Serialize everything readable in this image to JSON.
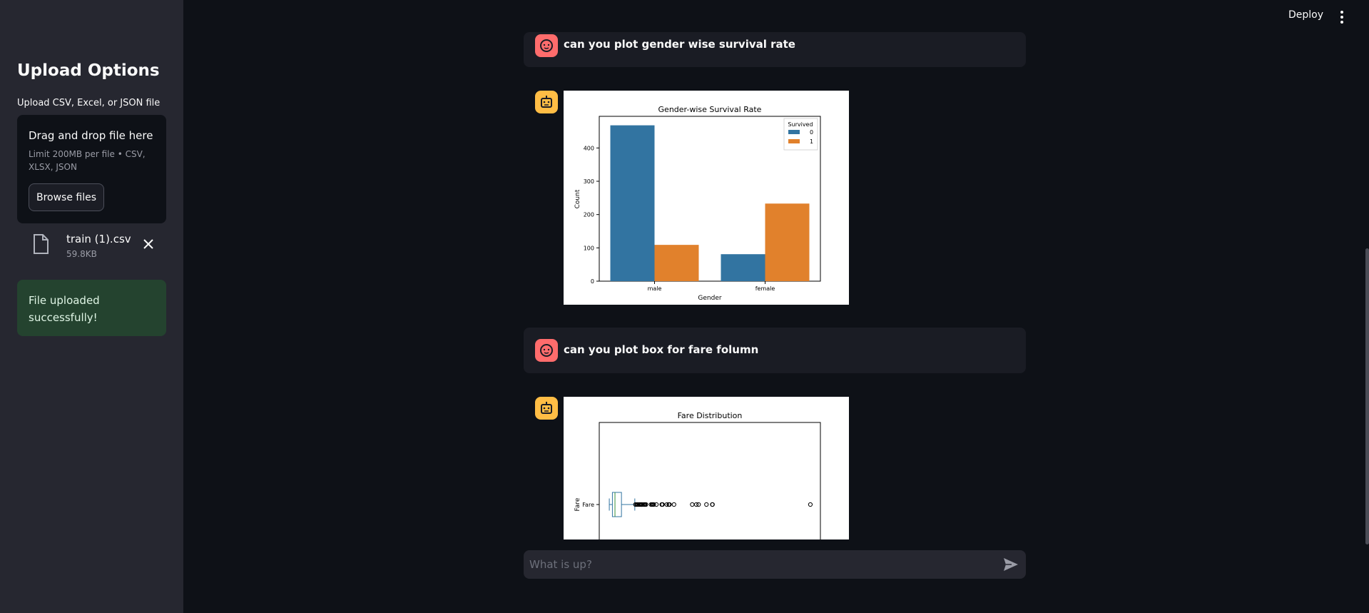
{
  "sidebar": {
    "title": "Upload Options",
    "upload_label": "Upload CSV, Excel, or JSON file",
    "dropzone": {
      "title": "Drag and drop file here",
      "limit": "Limit 200MB per file • CSV, XLSX, JSON",
      "browse_label": "Browse files"
    },
    "file": {
      "name": "train (1).csv",
      "size": "59.8KB"
    },
    "success_message": "File uploaded successfully!"
  },
  "header": {
    "deploy_label": "Deploy"
  },
  "chat": {
    "messages": [
      {
        "role": "user",
        "text": "can you plot gender wise survival rate"
      },
      {
        "role": "assistant",
        "content": "chart"
      },
      {
        "role": "user",
        "text": "can you plot box for fare folumn"
      },
      {
        "role": "assistant",
        "content": "chart"
      }
    ],
    "input_placeholder": "What is up?"
  },
  "chart_data": [
    {
      "type": "bar",
      "title": "Gender-wise Survival Rate",
      "xlabel": "Gender",
      "ylabel": "Count",
      "categories": [
        "male",
        "female"
      ],
      "series": [
        {
          "name": "0",
          "values": [
            468,
            81
          ],
          "color": "#3274a1"
        },
        {
          "name": "1",
          "values": [
            109,
            233
          ],
          "color": "#e1812c"
        }
      ],
      "legend_title": "Survived",
      "legend_position": "top-right",
      "ylim": [
        0,
        495
      ],
      "yticks": [
        0,
        100,
        200,
        300,
        400
      ],
      "grid": false
    },
    {
      "type": "box",
      "title": "Fare Distribution",
      "ylabel": "Fare",
      "category": "Fare",
      "orientation": "horizontal",
      "xlim": [
        -25.6,
        537.9
      ],
      "box": {
        "min": 0,
        "q1": 7.91,
        "median": 14.45,
        "q3": 31.0,
        "whisker_high": 65.0
      },
      "outliers": [
        66.6,
        69.55,
        71.28,
        73.5,
        76.73,
        77.96,
        79.2,
        80.0,
        81.86,
        82.17,
        83.16,
        86.5,
        89.1,
        90.0,
        91.08,
        93.5,
        106.43,
        108.9,
        110.88,
        113.28,
        120.0,
        133.65,
        134.5,
        135.63,
        146.52,
        151.55,
        153.46,
        164.87,
        211.34,
        221.78,
        227.53,
        247.52,
        262.38,
        263.0,
        512.33
      ],
      "color": "#3274a1"
    }
  ]
}
